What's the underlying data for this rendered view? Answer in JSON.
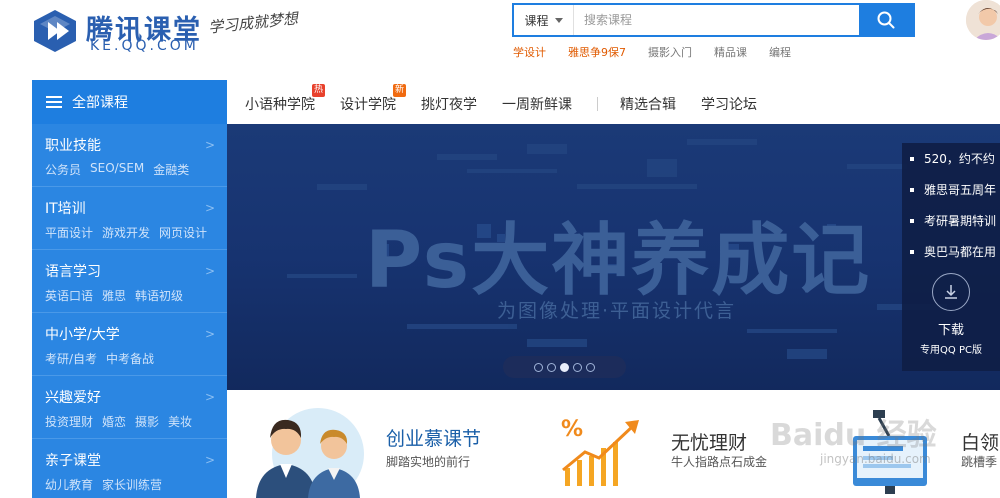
{
  "header": {
    "logo_cn": "腾讯课堂",
    "logo_en": "KE.QQ.COM",
    "slogan": "学习成就梦想"
  },
  "search": {
    "type_label": "课程",
    "placeholder": "搜索课程",
    "hotwords": [
      {
        "label": "学设计",
        "hot": true
      },
      {
        "label": "雅思争9保7",
        "hot": true
      },
      {
        "label": "摄影入门",
        "hot": false
      },
      {
        "label": "精品课",
        "hot": false
      },
      {
        "label": "编程",
        "hot": false
      }
    ]
  },
  "category_header": "全部课程",
  "topnav": {
    "items": [
      "小语种学院",
      "设计学院",
      "挑灯夜学",
      "一周新鲜课",
      "精选合辑",
      "学习论坛"
    ],
    "tags": {
      "hot": "热",
      "new": "新"
    }
  },
  "categories": [
    {
      "title": "职业技能",
      "subs": [
        "公务员",
        "SEO/SEM",
        "金融类"
      ]
    },
    {
      "title": "IT培训",
      "subs": [
        "平面设计",
        "游戏开发",
        "网页设计"
      ]
    },
    {
      "title": "语言学习",
      "subs": [
        "英语口语",
        "雅思",
        "韩语初级"
      ]
    },
    {
      "title": "中小学/大学",
      "subs": [
        "考研/自考",
        "中考备战"
      ]
    },
    {
      "title": "兴趣爱好",
      "subs": [
        "投资理财",
        "婚恋",
        "摄影",
        "美妆"
      ]
    },
    {
      "title": "亲子课堂",
      "subs": [
        "幼儿教育",
        "家长训练营"
      ]
    }
  ],
  "banner": {
    "title": "Ps大神养成记",
    "subtitle": "为图像处理·平面设计代言",
    "dots": 5,
    "active_dot": 3
  },
  "news": [
    "520，约不约",
    "雅思哥五周年",
    "考研暑期特训",
    "奥巴马都在用"
  ],
  "download": {
    "label": "下载",
    "sub": "专用QQ PC版"
  },
  "promos": [
    {
      "title": "创业慕课节",
      "sub": "脚踏实地的前行"
    },
    {
      "title": "无忧理财",
      "sub": "牛人指路点石成金"
    },
    {
      "title": "白领",
      "sub": "跳槽季"
    }
  ],
  "watermark": {
    "brand": "Baidu 经验",
    "url": "jingyan.baidu.com"
  },
  "colors": {
    "brand_blue": "#1e7ee0",
    "sidebar_blue": "#2b86e2",
    "hot_orange": "#e05a00",
    "banner_bg": "#173370"
  }
}
